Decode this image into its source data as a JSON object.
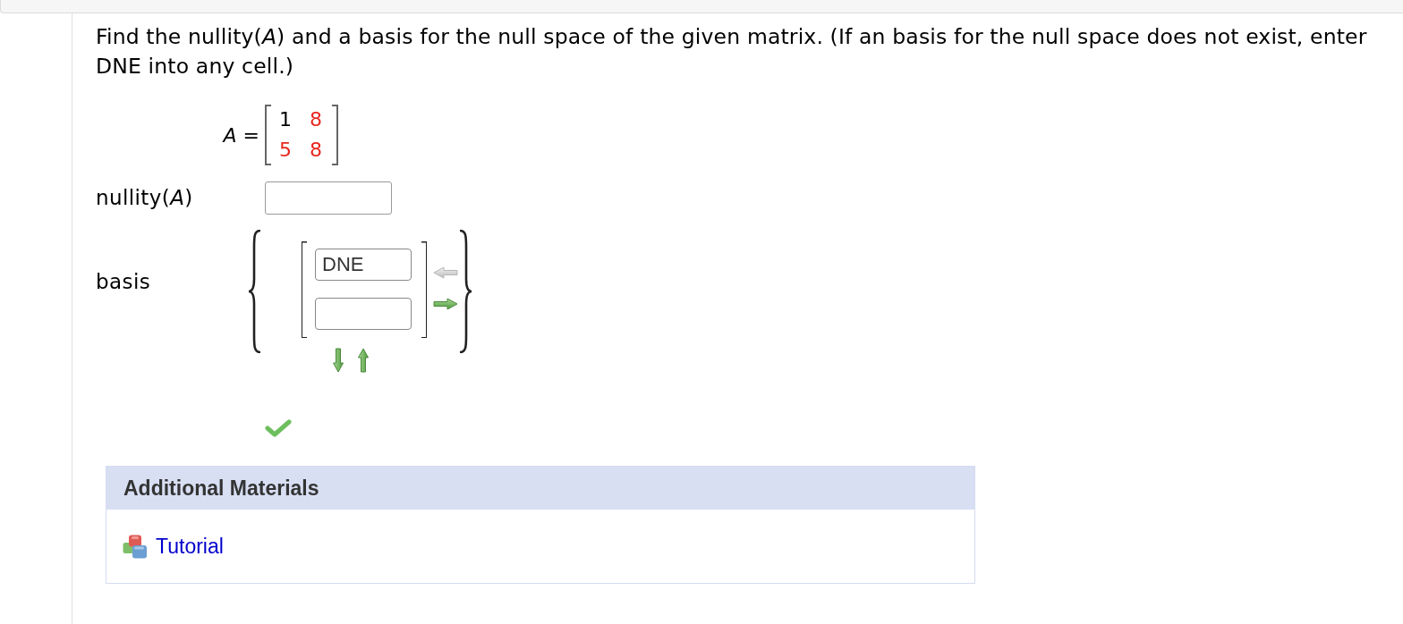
{
  "question": {
    "text": "Find the nullity(*A*) and a basis for the null space of the given matrix. (If an basis for the null space does not exist, enter DNE into any cell.)"
  },
  "matrix": {
    "label": "*A* =",
    "rows": [
      [
        {
          "value": "1",
          "color": "#000000"
        },
        {
          "value": "8",
          "color": "#e8271f"
        }
      ],
      [
        {
          "value": "5",
          "color": "#e8271f"
        },
        {
          "value": "8",
          "color": "#e8271f"
        }
      ]
    ]
  },
  "nullity": {
    "label": "nullity(*A*)"
  },
  "basis": {
    "label": "basis",
    "vector": [
      {
        "kind": "input",
        "value": "DNE"
      },
      {
        "kind": "input"
      }
    ],
    "column_controls": [
      {
        "kind": "left",
        "disabled": true
      },
      {
        "kind": "right",
        "disabled": false
      }
    ],
    "row_controls": [
      {
        "kind": "down",
        "disabled": false
      },
      {
        "kind": "up",
        "disabled": false
      }
    ]
  },
  "result": {
    "correct": true
  },
  "additional_materials": {
    "title": "Additional Materials",
    "links": [
      {
        "label": "Tutorial"
      }
    ]
  }
}
